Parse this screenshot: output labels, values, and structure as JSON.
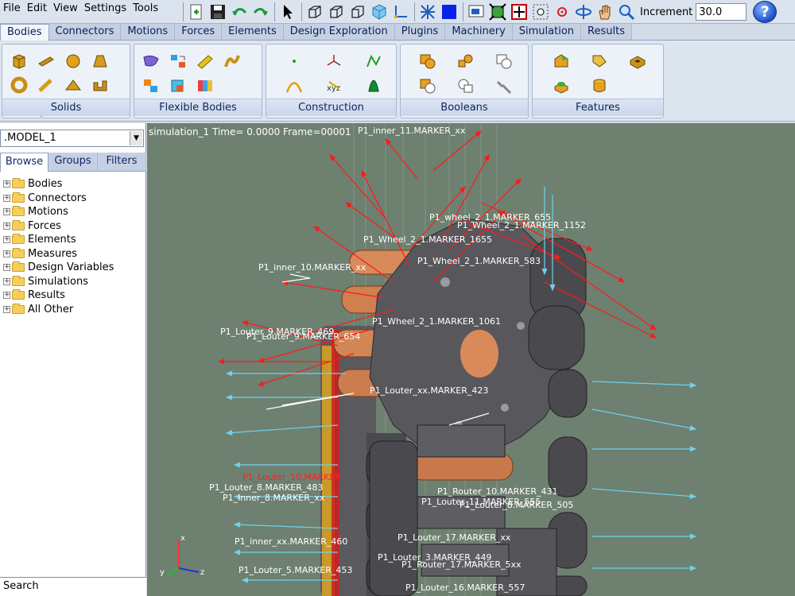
{
  "menubar": {
    "items": [
      "File",
      "Edit",
      "View",
      "Settings",
      "Tools"
    ]
  },
  "toolbar": {
    "icons": [
      "new-icon",
      "save-icon",
      "undo-icon",
      "redo-icon",
      "select-icon",
      "wireframe-icon",
      "wireframe-icon-2",
      "wireframe-icon-3",
      "shaded-icon",
      "axes-icon",
      "grid-icon",
      "color-icon",
      "render-icon",
      "fit-icon",
      "zoom-box-icon",
      "center-icon",
      "rotate-icon",
      "pan-icon",
      "zoom-icon"
    ],
    "increment_label": "Increment",
    "increment_value": "30.0",
    "help_label": "?"
  },
  "tabs": [
    "Bodies",
    "Connectors",
    "Motions",
    "Forces",
    "Elements",
    "Design Exploration",
    "Plugins",
    "Machinery",
    "Simulation",
    "Results"
  ],
  "ribbon": {
    "groups": [
      {
        "label": "Solids"
      },
      {
        "label": "Flexible Bodies"
      },
      {
        "label": "Construction"
      },
      {
        "label": "Booleans"
      },
      {
        "label": "Features"
      }
    ]
  },
  "left": {
    "model": ".MODEL_1",
    "subtabs": [
      "Browse",
      "Groups",
      "Filters"
    ],
    "tree": [
      "Bodies",
      "Connectors",
      "Motions",
      "Forces",
      "Elements",
      "Measures",
      "Design Variables",
      "Simulations",
      "Results",
      "All Other"
    ],
    "search_label": "Search"
  },
  "viewport": {
    "status": "simulation_1   Time=  0.0000  Frame=00001",
    "markers": [
      "P1_inner_11.MARKER_xx",
      "P1_inner_10.MARKER_xx",
      "P1_wheel_2_1.MARKER_655",
      "P1_Wheel_2_1.MARKER_1152",
      "P1_Wheel_2_1.MARKER_1655",
      "P1_Wheel_2_1.MARKER_583",
      "P1_Louter_9.MARKER_469",
      "P1_Louter_9.MARKER_654",
      "P1_Wheel_2_1.MARKER_1061",
      "P1_Louter_8.MARKER_483",
      "P1_Router_10.MARKER_431",
      "P1_Louter_11.MARKER_555",
      "P1_Louter_8.MARKER_505",
      "P1_Louter_17.MARKER_xx",
      "P1_Louter_5.MARKER_453",
      "P1_Router_17.MARKER_5xx",
      "P1_Louter_16.MARKER_557",
      "P1_Louter_10.MARKER",
      "P1_inner_8.MARKER_xx",
      "P1_Louter_xx.MARKER_423",
      "P1_Louter_3.MARKER_449",
      "P1_inner_xx.MARKER_460"
    ]
  },
  "colors": {
    "viewport_bg": "#6e8070",
    "arrow_red": "#ff1a1a",
    "arrow_cyan": "#6fd2ee"
  }
}
